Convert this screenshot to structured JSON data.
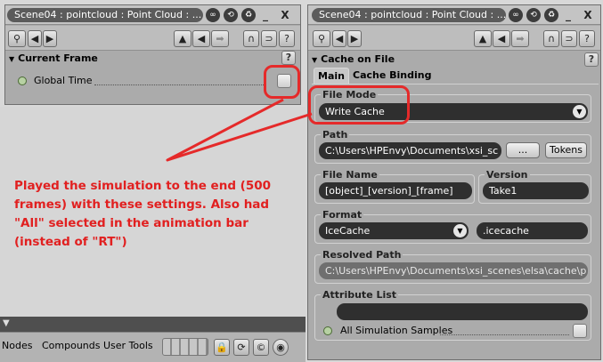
{
  "left_window": {
    "title": "Scene04 : pointcloud : Point Cloud : ...",
    "section": "Current Frame",
    "param_label": "Global Time"
  },
  "right_window": {
    "title": "Scene04 : pointcloud : Point Cloud : ...",
    "section": "Cache on File",
    "tabs": [
      "Main",
      "Cache Binding"
    ],
    "file_mode": {
      "label": "File Mode",
      "value": "Write Cache"
    },
    "path": {
      "label": "Path",
      "value": "C:\\Users\\HPEnvy\\Documents\\xsi_sc",
      "browse": "...",
      "tokens": "Tokens"
    },
    "file_name": {
      "label": "File Name",
      "value": "[object]_[version]_[frame]"
    },
    "version": {
      "label": "Version",
      "value": "Take1"
    },
    "format": {
      "label": "Format",
      "value": "IceCache",
      "ext": ".icecache"
    },
    "resolved_path": {
      "label": "Resolved Path",
      "value": "C:\\Users\\HPEnvy\\Documents\\xsi_scenes\\elsa\\cache\\p"
    },
    "attribute_list": {
      "label": "Attribute List",
      "checkbox_label": "All Simulation Samples"
    }
  },
  "bottom_bar": {
    "items": [
      "Nodes",
      "Compounds",
      "User Tools"
    ]
  },
  "annotation": "Played the simulation to the end (500 frames) with these settings. Also had \"All\" selected in the animation bar (instead of \"RT\")",
  "colors": {
    "annotation": "#e12020",
    "field_bg": "#2f2f2f",
    "panel_bg": "#ababab"
  },
  "icons": [
    "pin-icon",
    "back-icon",
    "forward-icon",
    "save-icon",
    "load-icon",
    "recycle-icon",
    "lock-icon",
    "help-icon"
  ]
}
